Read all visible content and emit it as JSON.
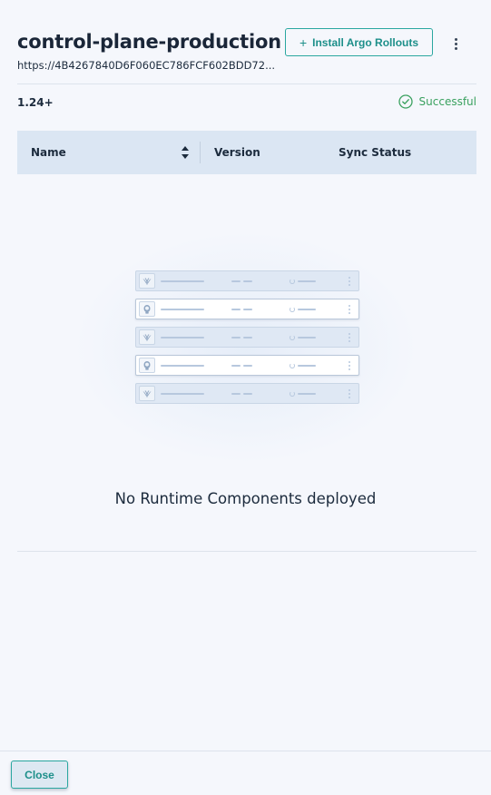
{
  "header": {
    "title": "control-plane-production ...",
    "url": "https://4B4267840D6F060EC786FCF602BDD72...",
    "install_button": {
      "icon": "plus-icon",
      "label": "Install Argo Rollouts"
    },
    "more_icon": "kebab-menu-icon"
  },
  "info": {
    "version": "1.24+",
    "status": {
      "icon": "check-circle-icon",
      "label": "Successful",
      "color": "#3aa15f"
    }
  },
  "table": {
    "columns": [
      "Name",
      "Version",
      "Sync Status"
    ],
    "sort_icon": "sort-icon",
    "empty_message": "No Runtime Components deployed"
  },
  "illustration": {
    "rows": [
      {
        "icon": "argo-rollouts-logo-icon",
        "style": "blue"
      },
      {
        "icon": "argo-cd-logo-icon",
        "style": "white"
      },
      {
        "icon": "argo-rollouts-logo-icon",
        "style": "blue"
      },
      {
        "icon": "argo-cd-logo-icon",
        "style": "white"
      },
      {
        "icon": "argo-rollouts-logo-icon",
        "style": "blue"
      }
    ]
  },
  "footer": {
    "close_label": "Close"
  },
  "colors": {
    "accent": "#2aa7a0",
    "header_bg": "#dbe6f3",
    "success": "#3aa15f"
  }
}
